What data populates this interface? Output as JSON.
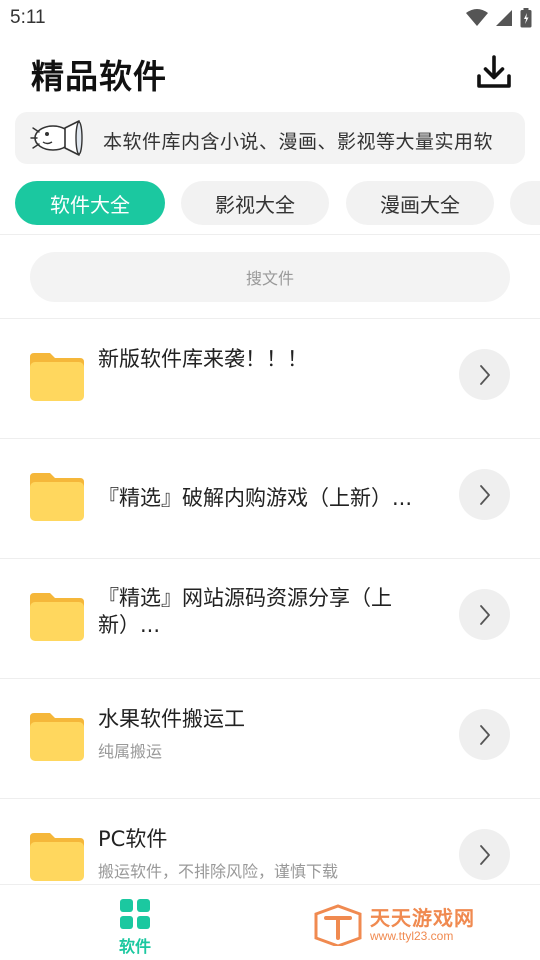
{
  "status_bar": {
    "time": "5:11",
    "icons": [
      "wifi-icon",
      "signal-icon",
      "battery-icon"
    ]
  },
  "header": {
    "title": "精品软件",
    "download_icon": "download-icon"
  },
  "notice": {
    "icon": "megaphone-icon",
    "text": "本软件库内含小说、漫画、影视等大量实用软"
  },
  "tabs": [
    {
      "label": "软件大全",
      "active": true
    },
    {
      "label": "影视大全",
      "active": false
    },
    {
      "label": "漫画大全",
      "active": false
    },
    {
      "label": "",
      "active": false
    }
  ],
  "search": {
    "placeholder": "搜文件"
  },
  "list": [
    {
      "title": "新版软件库来袭！！！",
      "subtitle": ""
    },
    {
      "title": "『精选』破解内购游戏（上新）...",
      "subtitle": ""
    },
    {
      "title": "『精选』网站源码资源分享（上新）...",
      "subtitle": ""
    },
    {
      "title": "水果软件搬运工",
      "subtitle": "纯属搬运"
    },
    {
      "title": "PC软件",
      "subtitle": "搬运软件，不排除风险，谨慎下载"
    }
  ],
  "bottom_nav": {
    "items": [
      {
        "label": "软件",
        "icon": "grid-icon",
        "active": true
      }
    ]
  },
  "watermark": {
    "name": "天天游戏网",
    "url": "www.ttyl23.com"
  },
  "colors": {
    "accent": "#1bc8a0",
    "folder": "#ffd75e",
    "folder_tab": "#f5b73a",
    "watermark": "#f08a50"
  }
}
